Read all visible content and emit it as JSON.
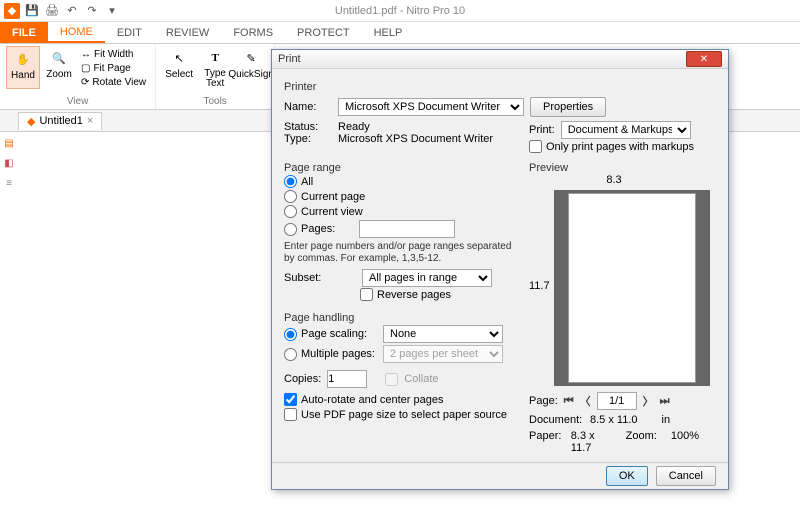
{
  "app": {
    "title": "Untitled1.pdf - Nitro Pro 10"
  },
  "menus": {
    "file": "FILE",
    "home": "HOME",
    "edit": "EDIT",
    "review": "REVIEW",
    "forms": "FORMS",
    "protect": "PROTECT",
    "help": "HELP"
  },
  "ribbon": {
    "hand": "Hand",
    "zoom": "Zoom",
    "fitwidth": "Fit Width",
    "fitpage": "Fit Page",
    "rotate": "Rotate View",
    "select": "Select",
    "typetext": "Type\nText",
    "quicksign": "QuickSign",
    "group_view": "View",
    "group_tools": "Tools"
  },
  "tab": {
    "name": "Untitled1"
  },
  "dialog": {
    "title": "Print",
    "printer_section": "Printer",
    "name_label": "Name:",
    "printer_name": "Microsoft XPS Document Writer",
    "properties": "Properties",
    "status_label": "Status:",
    "status_value": "Ready",
    "type_label": "Type:",
    "type_value": "Microsoft XPS Document Writer",
    "print_label": "Print:",
    "print_what": "Document & Markups",
    "only_markups": "Only print pages with markups",
    "page_range": "Page range",
    "all": "All",
    "current_page": "Current page",
    "current_view": "Current view",
    "pages": "Pages:",
    "hint": "Enter page numbers and/or page ranges separated by commas. For example, 1,3,5-12.",
    "subset_label": "Subset:",
    "subset_value": "All pages in range",
    "reverse": "Reverse pages",
    "page_handling": "Page handling",
    "page_scaling": "Page scaling:",
    "scaling_value": "None",
    "multiple_pages": "Multiple pages:",
    "multiple_value": "2 pages per sheet",
    "copies_label": "Copies:",
    "copies_value": "1",
    "collate": "Collate",
    "auto_rotate": "Auto-rotate and center pages",
    "use_pdf_size": "Use PDF page size to select paper source",
    "preview": "Preview",
    "w": "8.3",
    "h": "11.7",
    "page_label": "Page:",
    "page_field": "1/1",
    "document_label": "Document:",
    "document_size": "8.5 x 11.0",
    "unit": "in",
    "paper_label": "Paper:",
    "paper_size": "8.3 x 11.7",
    "zoom_label": "Zoom:",
    "zoom_value": "100%",
    "ok": "OK",
    "cancel": "Cancel"
  }
}
